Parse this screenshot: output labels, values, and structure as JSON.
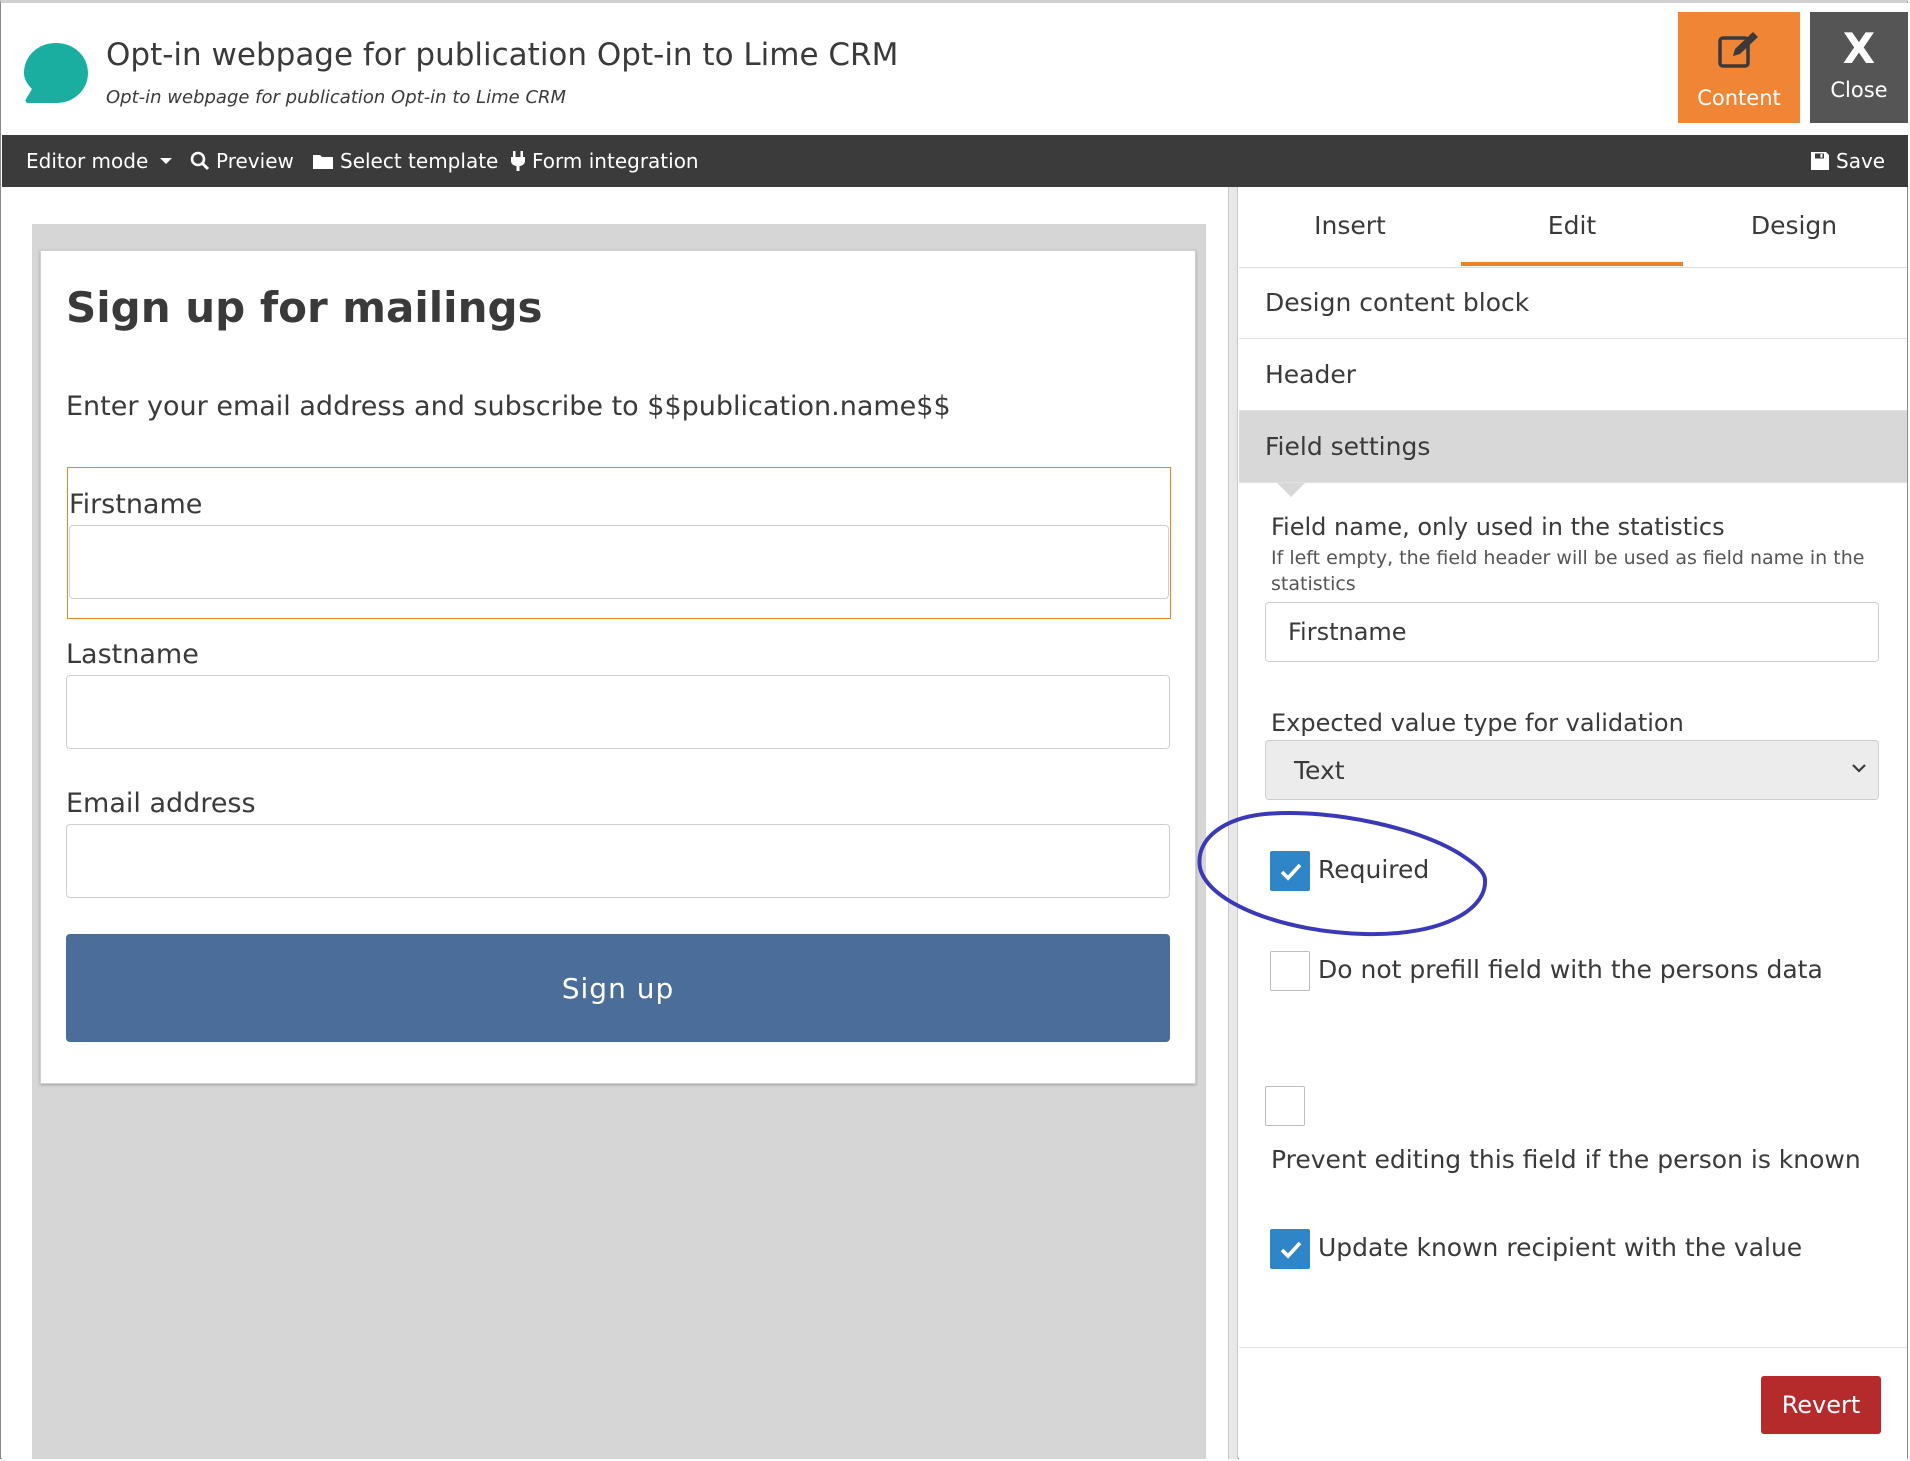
{
  "header": {
    "title": "Opt-in webpage for publication Opt-in to Lime CRM",
    "subtitle": "Opt-in webpage for publication Opt-in to Lime CRM",
    "content_button": "Content",
    "close_glyph": "X",
    "close_button": "Close"
  },
  "toolbar": {
    "editor_mode": "Editor mode",
    "preview": "Preview",
    "select_template": "Select template",
    "form_integration": "Form integration",
    "save": "Save"
  },
  "form": {
    "title": "Sign up for mailings",
    "description": "Enter your email address and subscribe to $$publication.name$$",
    "fields": [
      {
        "label": "Firstname"
      },
      {
        "label": "Lastname"
      },
      {
        "label": "Email address"
      }
    ],
    "submit_label": "Sign up"
  },
  "panel": {
    "tabs": [
      {
        "label": "Insert"
      },
      {
        "label": "Edit",
        "active": true
      },
      {
        "label": "Design"
      }
    ],
    "sections": [
      {
        "label": "Design content block"
      },
      {
        "label": "Header"
      },
      {
        "label": "Field settings",
        "active": true
      }
    ],
    "field_name_label": "Field name, only used in the statistics",
    "field_name_hint": "If left empty, the field header will be used as field name in the statistics",
    "field_name_value": "Firstname",
    "value_type_label": "Expected value type for validation",
    "value_type_selected": "Text",
    "required_label": "Required",
    "required_checked": true,
    "no_prefill_label": "Do not prefill field with the persons data",
    "no_prefill_checked": false,
    "prevent_edit_label": "Prevent editing this field if the person is known",
    "prevent_edit_checked": false,
    "update_known_label": "Update known recipient with the value",
    "update_known_checked": true,
    "revert_label": "Revert"
  },
  "colors": {
    "accent_orange": "#f08536",
    "toolbar_bg": "#3b3b3b",
    "signup_button": "#4a6e99",
    "checkbox_blue": "#2e86c8",
    "revert_red": "#b52a2a",
    "annotation_ink": "#3a3ab8"
  },
  "icons": {
    "logo": "speech-bubble-icon",
    "content": "pencil-square-icon",
    "preview": "search-icon",
    "select_template": "folder-icon",
    "form_integration": "plug-icon",
    "save": "floppy-disk-icon",
    "editor_mode": "caret-down-icon",
    "select": "chevron-down-icon",
    "check": "check-icon"
  }
}
